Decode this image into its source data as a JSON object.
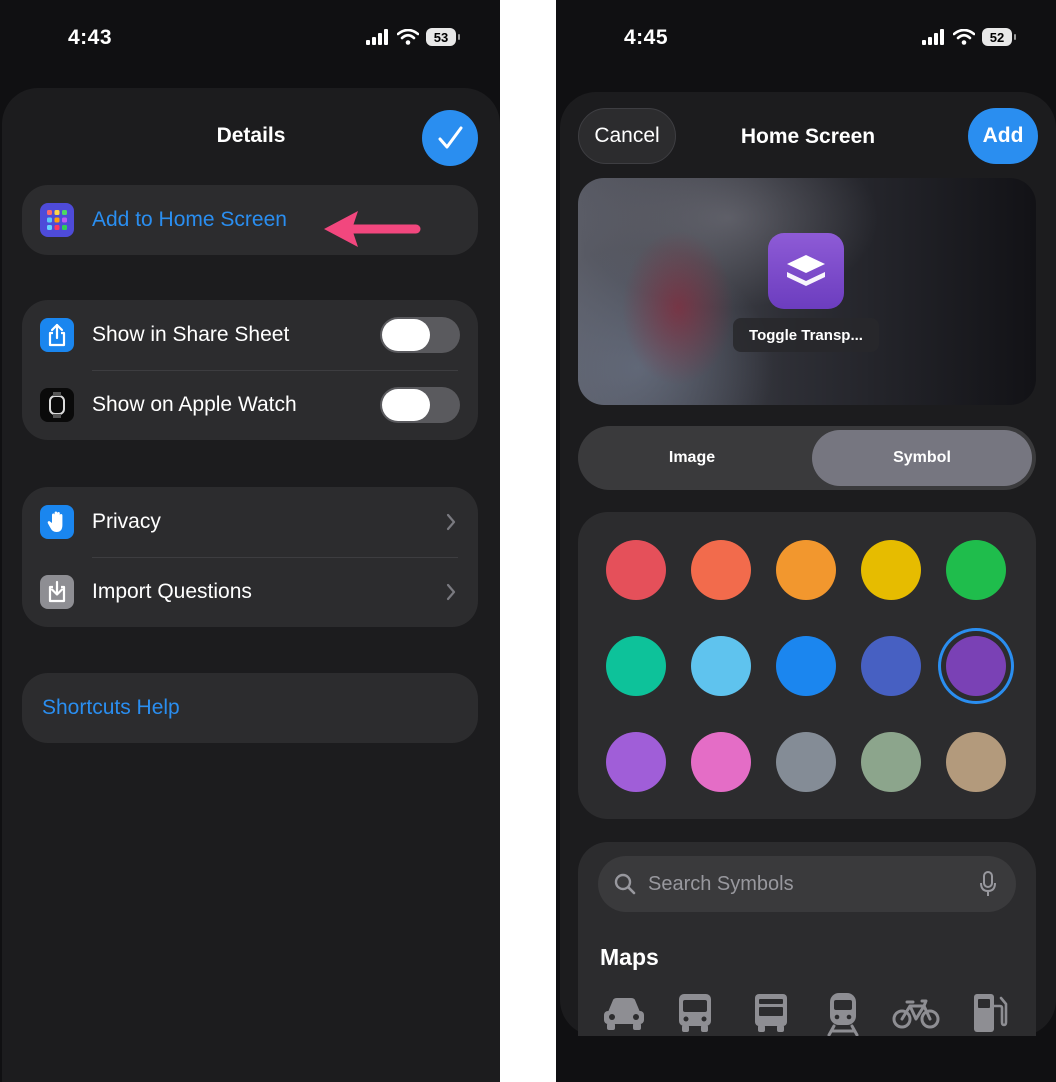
{
  "left_screen": {
    "status": {
      "time": "4:43",
      "battery": "53"
    },
    "title": "Details",
    "add_to_home": "Add to Home Screen",
    "share_sheet": "Show in Share Sheet",
    "apple_watch": "Show on Apple Watch",
    "privacy": "Privacy",
    "import_questions": "Import Questions",
    "help": "Shortcuts Help"
  },
  "right_screen": {
    "status": {
      "time": "4:45",
      "battery": "52"
    },
    "title": "Home Screen",
    "cancel": "Cancel",
    "add": "Add",
    "app_name": "Toggle Transp...",
    "tabs": {
      "image": "Image",
      "symbol": "Symbol",
      "selected": "Symbol"
    },
    "colors": [
      "#e5505a",
      "#f26b4c",
      "#f2972e",
      "#e6bc00",
      "#1fbd4c",
      "#0dc29a",
      "#5fc3ee",
      "#1b86ef",
      "#4760c2",
      "#7a41b5",
      "#a05ed8",
      "#e46dc6",
      "#848c96",
      "#8ca58c",
      "#b39a7c"
    ],
    "selected_color_index": 9,
    "search_placeholder": "Search Symbols",
    "section": "Maps",
    "symbols": [
      "car-icon",
      "bus-icon",
      "tram-icon",
      "train-icon",
      "bicycle-icon",
      "fuel-pump-icon"
    ]
  },
  "colors": {
    "accent": "#2a8ef0",
    "annotation_arrow": "#f2477e"
  }
}
